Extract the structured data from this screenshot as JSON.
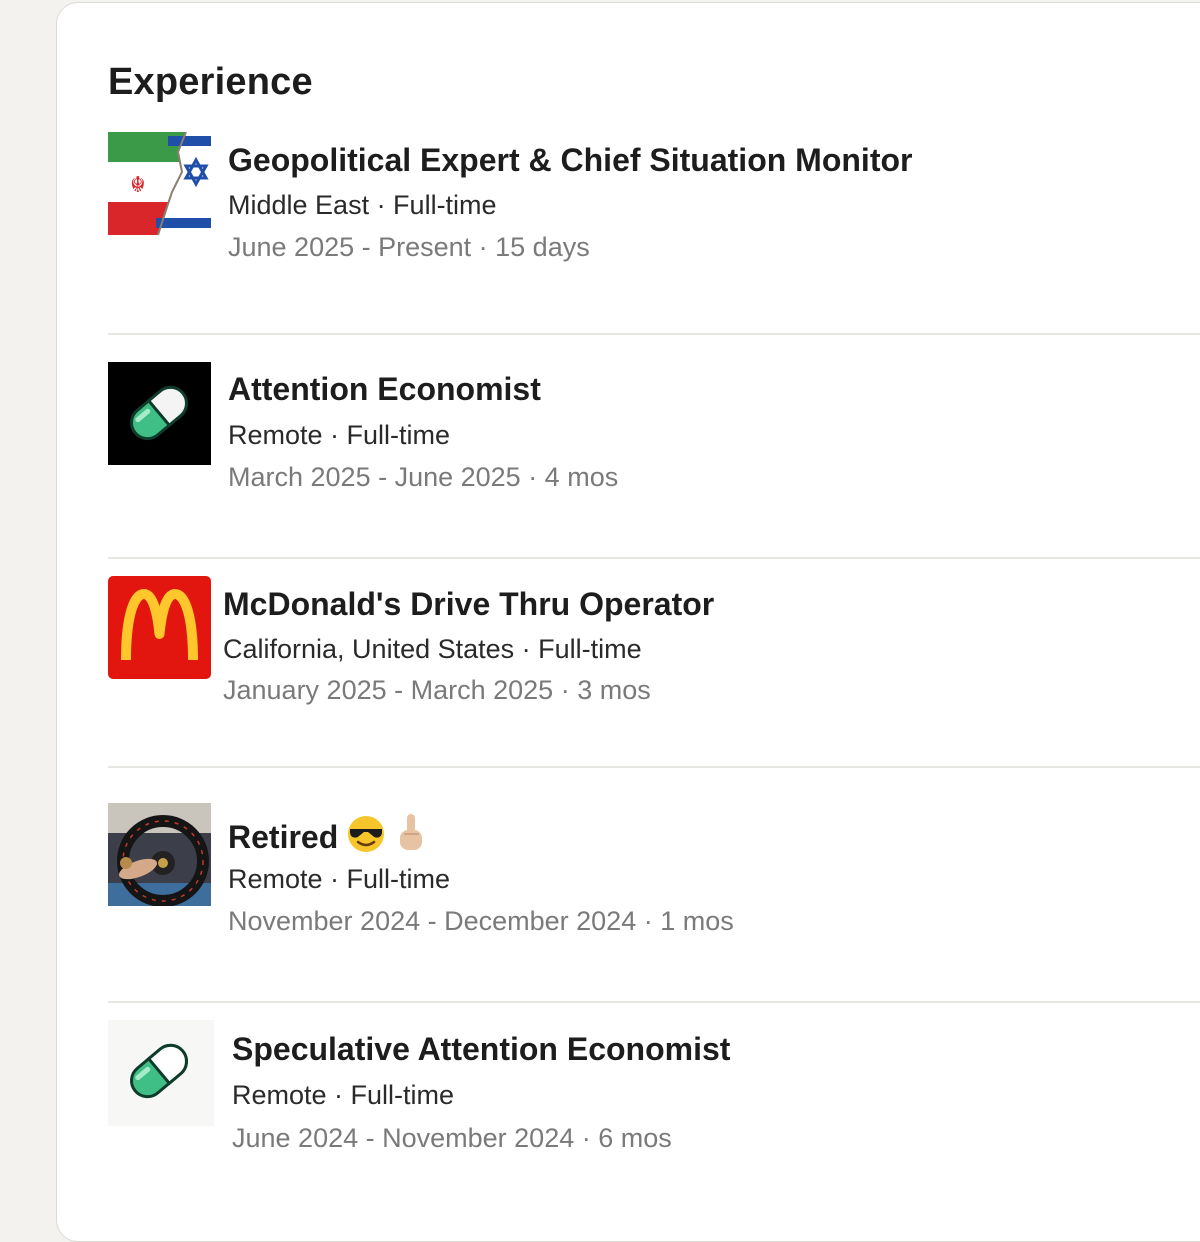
{
  "section": {
    "title": "Experience"
  },
  "experiences": [
    {
      "title": "Geopolitical Expert & Chief Situation Monitor",
      "location_type": "Middle East · Full-time",
      "dates": "June 2025 - Present · 15 days",
      "logo_icon": "iran-israel-flags-icon"
    },
    {
      "title": "Attention Economist",
      "location_type": "Remote · Full-time",
      "dates": "March 2025 - June 2025 · 4 mos",
      "logo_icon": "pill-icon-dark"
    },
    {
      "title": "McDonald's Drive Thru Operator",
      "location_type": "California, United States · Full-time",
      "dates": "January 2025 - March 2025 · 3 mos",
      "logo_icon": "mcdonalds-logo-icon"
    },
    {
      "title": "Retired",
      "location_type": "Remote · Full-time",
      "dates": "November 2024 - December 2024 · 1 mos",
      "logo_icon": "steering-wheel-photo-icon",
      "title_emojis": [
        "sunglasses-emoji-icon",
        "middle-finger-emoji-icon"
      ]
    },
    {
      "title": "Speculative Attention Economist",
      "location_type": "Remote · Full-time",
      "dates": "June 2024 - November 2024 · 6 mos",
      "logo_icon": "pill-icon-light"
    }
  ],
  "colors": {
    "page_background": "#f3f2ee",
    "card_background": "#ffffff",
    "title_text": "#1d1d1d",
    "meta_text": "#2a2a2a",
    "date_text": "#7a7a7a",
    "divider": "#e7e6e2",
    "pill_green": "#3fbf85",
    "mcdonalds_red": "#e2150f",
    "mcdonalds_yellow": "#ffc72c"
  }
}
